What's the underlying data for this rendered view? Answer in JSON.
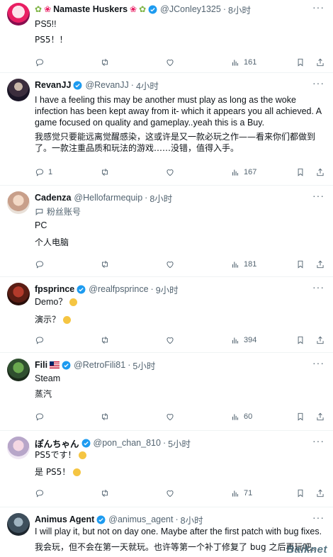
{
  "colors": {
    "verified": "#1d9bf0",
    "muted": "#536471",
    "text": "#0f1419",
    "divider": "#eff3f4"
  },
  "icons": [
    "reply-icon",
    "retweet-icon",
    "like-icon",
    "views-icon",
    "bookmark-icon",
    "share-icon",
    "verified-badge-icon",
    "more-icon"
  ],
  "tweets": [
    {
      "name": "Namaste Huskers",
      "handle": "@JConley1325",
      "time": "8小时",
      "lines": [
        "PS5!!",
        "PS5！！"
      ],
      "reply": "",
      "views": "161"
    },
    {
      "name": "RevanJJ",
      "handle": "@RevanJJ",
      "time": "4小时",
      "lines": [
        "I have a feeling this may be another must play as long as the woke infection has been kept away from it- which it appears you all achieved. A game focused on quality and gameplay..yeah this is a Buy.",
        "我感觉只要能远离觉醒感染，这或许是又一款必玩之作——看来你们都做到了。一款注重品质和玩法的游戏……没错，值得入手。"
      ],
      "reply": "1",
      "views": "167"
    },
    {
      "name": "Cadenza",
      "handle": "@Hellofarmequip",
      "time": "8小时",
      "fan_label": "粉丝账号",
      "lines": [
        "PC",
        "个人电脑"
      ],
      "reply": "",
      "views": "181"
    },
    {
      "name": "fpsprince",
      "handle": "@realfpsprince",
      "time": "9小时",
      "lines": [
        "Demo？",
        "演示？"
      ],
      "reply": "",
      "views": "394"
    },
    {
      "name": "Fili",
      "handle": "@RetroFili81",
      "time": "5小时",
      "lines": [
        "Steam",
        "蒸汽"
      ],
      "reply": "",
      "views": "60"
    },
    {
      "name": "ぽんちゃん",
      "handle": "@pon_chan_810",
      "time": "5小时",
      "lines": [
        "PS5です！",
        "是 PS5！"
      ],
      "reply": "",
      "views": "71"
    },
    {
      "name": "Animus Agent",
      "handle": "@animus_agent",
      "time": "8小时",
      "lines": [
        "I will play it, but not on day one. Maybe after the first patch with bug fixes.",
        "我会玩，但不会在第一天就玩。也许等第一个补丁修复了 bug 之后再玩吧。"
      ]
    }
  ],
  "dot": "·",
  "more": "···",
  "watermark": "Baiknet"
}
